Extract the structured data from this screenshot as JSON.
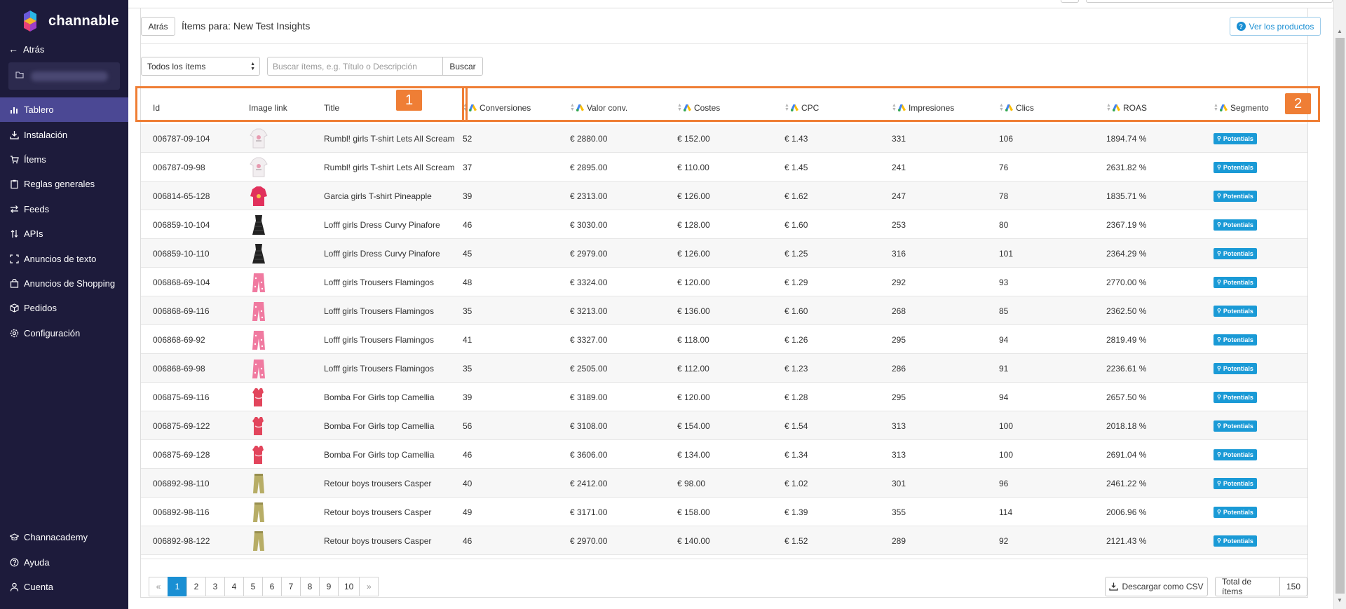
{
  "sidebar": {
    "brand": "channable",
    "back_label": "Atrás",
    "items": [
      {
        "label": "Tablero",
        "icon": "chart-bar-icon"
      },
      {
        "label": "Instalación",
        "icon": "download-tray-icon"
      },
      {
        "label": "Ítems",
        "icon": "cart-icon"
      },
      {
        "label": "Reglas generales",
        "icon": "clipboard-icon"
      },
      {
        "label": "Feeds",
        "icon": "exchange-icon"
      },
      {
        "label": "APIs",
        "icon": "sort-arrows-icon"
      },
      {
        "label": "Anuncios de texto",
        "icon": "expand-icon"
      },
      {
        "label": "Anuncios de Shopping",
        "icon": "shopping-bag-icon"
      },
      {
        "label": "Pedidos",
        "icon": "box-icon"
      },
      {
        "label": "Configuración",
        "icon": "gear-icon"
      }
    ],
    "bottom_items": [
      {
        "label": "Channacademy",
        "icon": "graduation-cap-icon"
      },
      {
        "label": "Ayuda",
        "icon": "question-circle-icon"
      },
      {
        "label": "Cuenta",
        "icon": "user-icon"
      }
    ],
    "active_color": "#4b4894",
    "bg_color": "#1d1b3b"
  },
  "header": {
    "back_button": "Atrás",
    "title": "Ítems para: New Test Insights",
    "view_products": "Ver los productos"
  },
  "filters": {
    "select_value": "Todos los ítems",
    "search_placeholder": "Buscar ítems, e.g. Título o Descripción",
    "search_button": "Buscar"
  },
  "annotations": {
    "box1": "1",
    "box2": "2",
    "color": "#ef7e35"
  },
  "table": {
    "columns": {
      "id": "Id",
      "image": "Image link",
      "title": "Title",
      "conversions": "Conversiones",
      "conv_value": "Valor conv.",
      "costs": "Costes",
      "cpc": "CPC",
      "impressions": "Impresiones",
      "clicks": "Clics",
      "roas": "ROAS",
      "segment": "Segmento"
    },
    "rows": [
      {
        "id": "006787-09-104",
        "img": "white-shirt",
        "title": "Rumbl! girls T-shirt Lets All Scream",
        "conv": "52",
        "value": "€ 2880.00",
        "cost": "€ 152.00",
        "cpc": "€ 1.43",
        "imp": "331",
        "clicks": "106",
        "roas": "1894.74 %",
        "segment": "Potentials"
      },
      {
        "id": "006787-09-98",
        "img": "white-shirt",
        "title": "Rumbl! girls T-shirt Lets All Scream",
        "conv": "37",
        "value": "€ 2895.00",
        "cost": "€ 110.00",
        "cpc": "€ 1.45",
        "imp": "241",
        "clicks": "76",
        "roas": "2631.82 %",
        "segment": "Potentials"
      },
      {
        "id": "006814-65-128",
        "img": "pink-shirt",
        "title": "Garcia girls T-shirt Pineapple",
        "conv": "39",
        "value": "€ 2313.00",
        "cost": "€ 126.00",
        "cpc": "€ 1.62",
        "imp": "247",
        "clicks": "78",
        "roas": "1835.71 %",
        "segment": "Potentials"
      },
      {
        "id": "006859-10-104",
        "img": "black-dress",
        "title": "Lofff girls Dress Curvy Pinafore",
        "conv": "46",
        "value": "€ 3030.00",
        "cost": "€ 128.00",
        "cpc": "€ 1.60",
        "imp": "253",
        "clicks": "80",
        "roas": "2367.19 %",
        "segment": "Potentials"
      },
      {
        "id": "006859-10-110",
        "img": "black-dress",
        "title": "Lofff girls Dress Curvy Pinafore",
        "conv": "45",
        "value": "€ 2979.00",
        "cost": "€ 126.00",
        "cpc": "€ 1.25",
        "imp": "316",
        "clicks": "101",
        "roas": "2364.29 %",
        "segment": "Potentials"
      },
      {
        "id": "006868-69-104",
        "img": "pink-trousers",
        "title": "Lofff girls Trousers Flamingos",
        "conv": "48",
        "value": "€ 3324.00",
        "cost": "€ 120.00",
        "cpc": "€ 1.29",
        "imp": "292",
        "clicks": "93",
        "roas": "2770.00 %",
        "segment": "Potentials"
      },
      {
        "id": "006868-69-116",
        "img": "pink-trousers",
        "title": "Lofff girls Trousers Flamingos",
        "conv": "35",
        "value": "€ 3213.00",
        "cost": "€ 136.00",
        "cpc": "€ 1.60",
        "imp": "268",
        "clicks": "85",
        "roas": "2362.50 %",
        "segment": "Potentials"
      },
      {
        "id": "006868-69-92",
        "img": "pink-trousers",
        "title": "Lofff girls Trousers Flamingos",
        "conv": "41",
        "value": "€ 3327.00",
        "cost": "€ 118.00",
        "cpc": "€ 1.26",
        "imp": "295",
        "clicks": "94",
        "roas": "2819.49 %",
        "segment": "Potentials"
      },
      {
        "id": "006868-69-98",
        "img": "pink-trousers",
        "title": "Lofff girls Trousers Flamingos",
        "conv": "35",
        "value": "€ 2505.00",
        "cost": "€ 112.00",
        "cpc": "€ 1.23",
        "imp": "286",
        "clicks": "91",
        "roas": "2236.61 %",
        "segment": "Potentials"
      },
      {
        "id": "006875-69-116",
        "img": "red-top",
        "title": "Bomba For Girls top Camellia",
        "conv": "39",
        "value": "€ 3189.00",
        "cost": "€ 120.00",
        "cpc": "€ 1.28",
        "imp": "295",
        "clicks": "94",
        "roas": "2657.50 %",
        "segment": "Potentials"
      },
      {
        "id": "006875-69-122",
        "img": "red-top",
        "title": "Bomba For Girls top Camellia",
        "conv": "56",
        "value": "€ 3108.00",
        "cost": "€ 154.00",
        "cpc": "€ 1.54",
        "imp": "313",
        "clicks": "100",
        "roas": "2018.18 %",
        "segment": "Potentials"
      },
      {
        "id": "006875-69-128",
        "img": "red-top",
        "title": "Bomba For Girls top Camellia",
        "conv": "46",
        "value": "€ 3606.00",
        "cost": "€ 134.00",
        "cpc": "€ 1.34",
        "imp": "313",
        "clicks": "100",
        "roas": "2691.04 %",
        "segment": "Potentials"
      },
      {
        "id": "006892-98-110",
        "img": "khaki-trousers",
        "title": "Retour boys trousers Casper",
        "conv": "40",
        "value": "€ 2412.00",
        "cost": "€ 98.00",
        "cpc": "€ 1.02",
        "imp": "301",
        "clicks": "96",
        "roas": "2461.22 %",
        "segment": "Potentials"
      },
      {
        "id": "006892-98-116",
        "img": "khaki-trousers",
        "title": "Retour boys trousers Casper",
        "conv": "49",
        "value": "€ 3171.00",
        "cost": "€ 158.00",
        "cpc": "€ 1.39",
        "imp": "355",
        "clicks": "114",
        "roas": "2006.96 %",
        "segment": "Potentials"
      },
      {
        "id": "006892-98-122",
        "img": "khaki-trousers",
        "title": "Retour boys trousers Casper",
        "conv": "46",
        "value": "€ 2970.00",
        "cost": "€ 140.00",
        "cpc": "€ 1.52",
        "imp": "289",
        "clicks": "92",
        "roas": "2121.43 %",
        "segment": "Potentials"
      }
    ]
  },
  "pagination": {
    "prev": "«",
    "pages": [
      "1",
      "2",
      "3",
      "4",
      "5",
      "6",
      "7",
      "8",
      "9",
      "10"
    ],
    "next": "»",
    "active": "1"
  },
  "footer": {
    "csv_button": "Descargar como CSV",
    "total_label": "Total de ítems",
    "total_value": "150"
  },
  "colors": {
    "accent": "#1a8fd3",
    "badge": "#1a9ad6"
  }
}
